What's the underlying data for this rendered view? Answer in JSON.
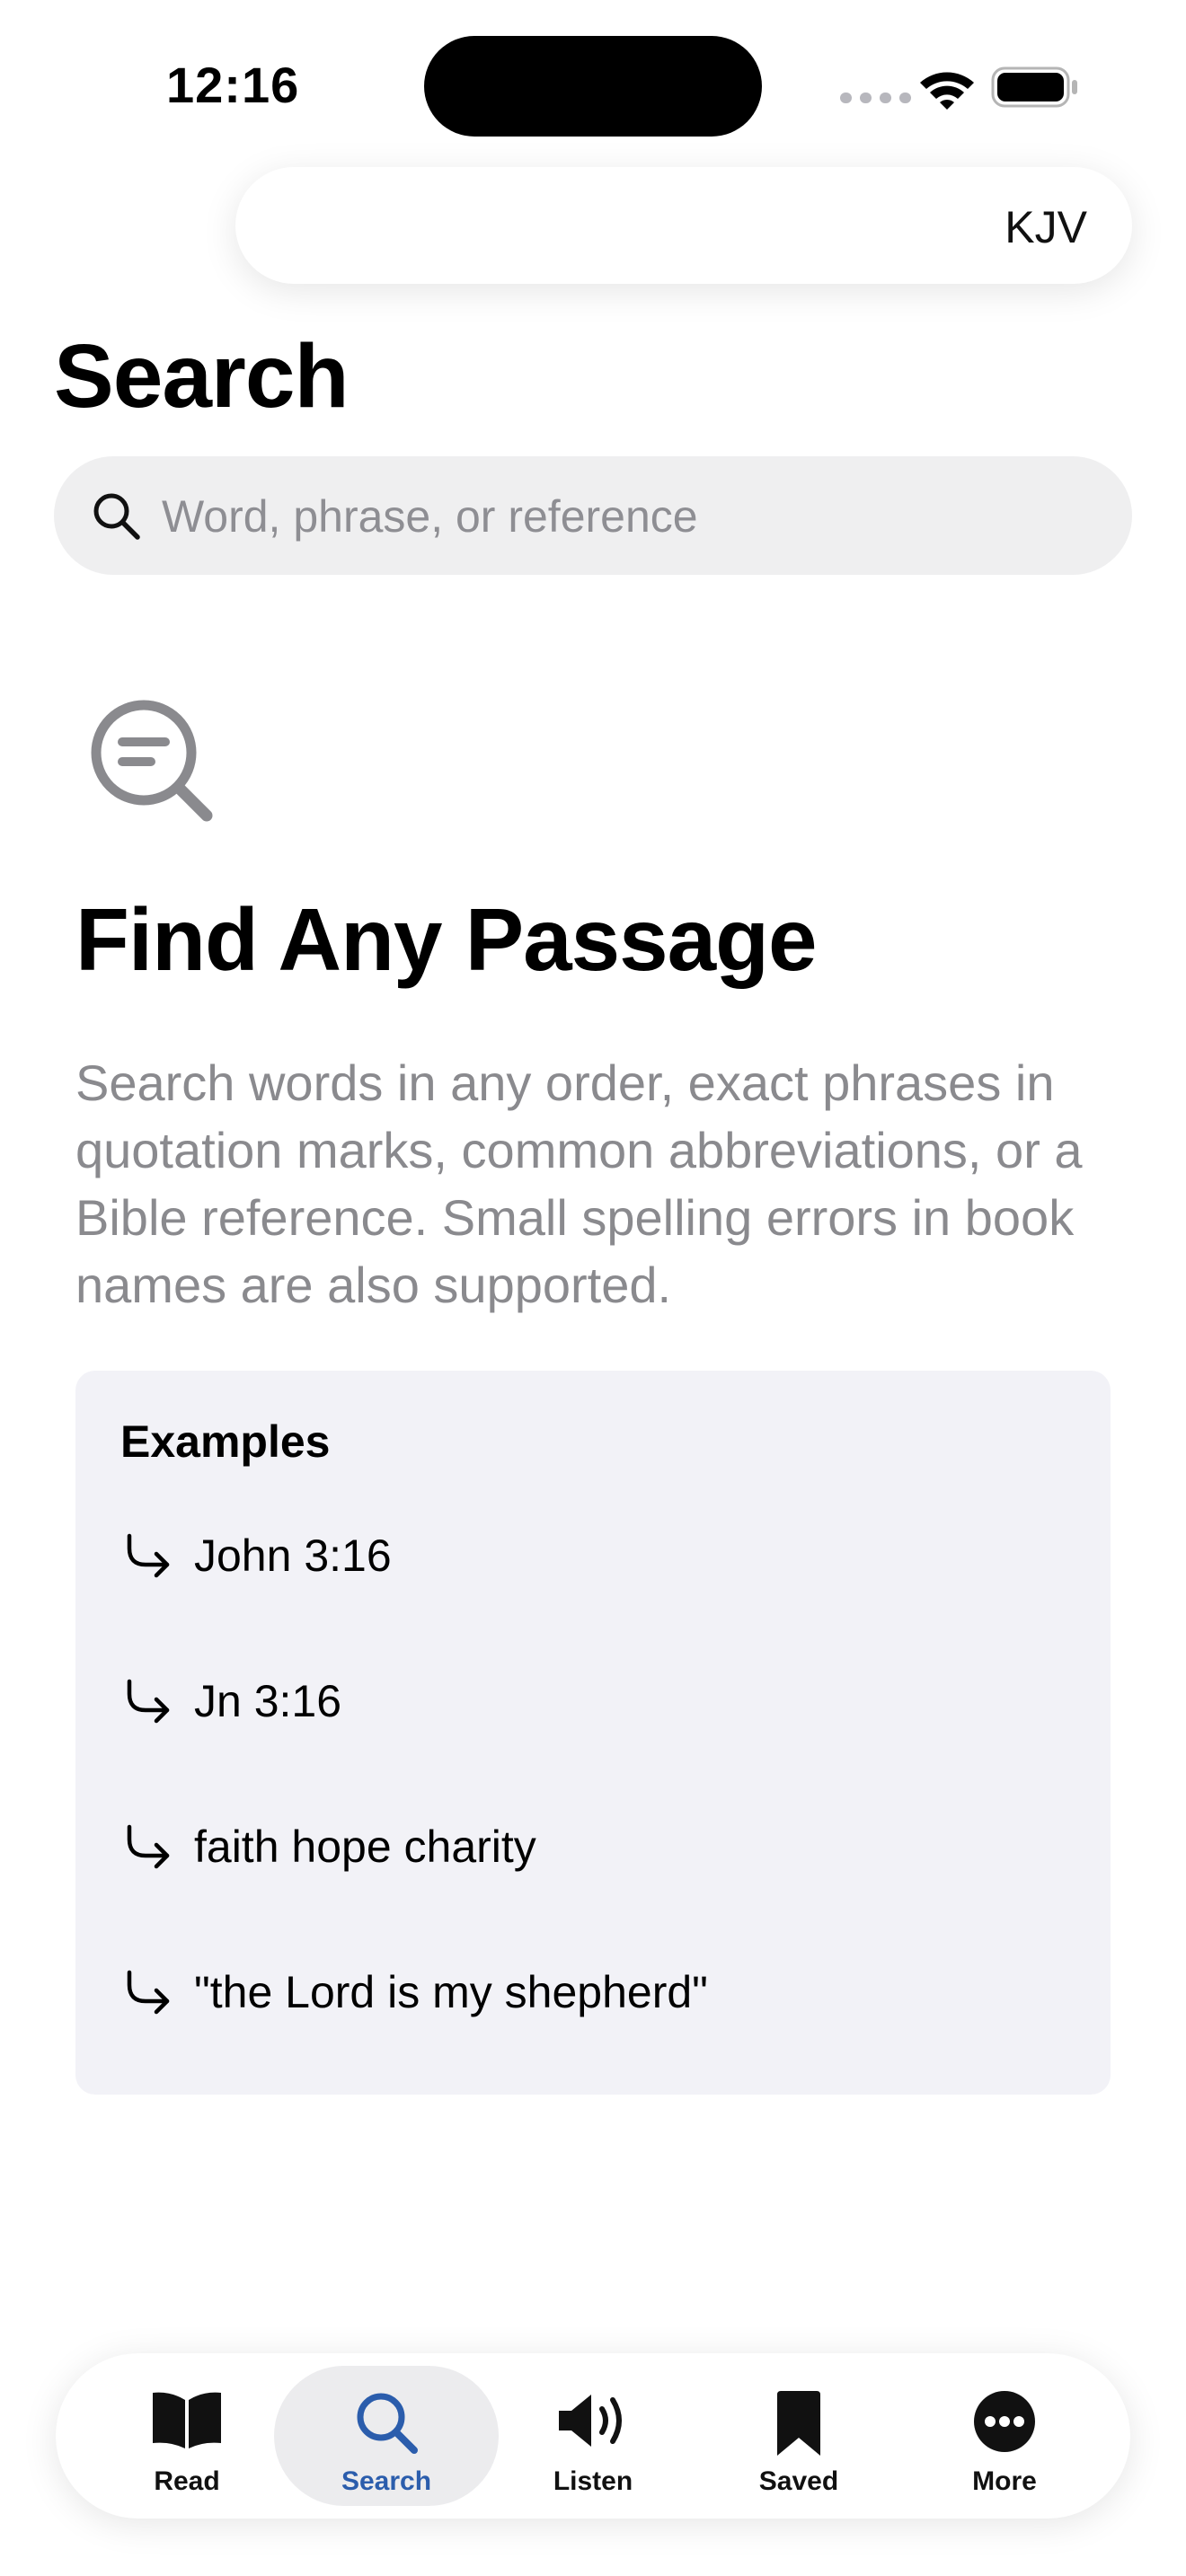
{
  "status_bar": {
    "time": "12:16"
  },
  "header": {
    "version": "KJV"
  },
  "page": {
    "title": "Search"
  },
  "search": {
    "placeholder": "Word, phrase, or reference",
    "value": ""
  },
  "hero": {
    "icon": "magnifier-lines-icon",
    "title": "Find Any Passage",
    "description": "Search words in any order, exact phrases in quotation marks, common abbreviations, or a Bible reference. Small spelling errors in book names are also supported."
  },
  "examples": {
    "title": "Examples",
    "items": [
      {
        "icon": "arrow-turn-right-icon",
        "label": "John 3:16"
      },
      {
        "icon": "arrow-turn-right-icon",
        "label": "Jn 3:16"
      },
      {
        "icon": "arrow-turn-right-icon",
        "label": "faith hope charity"
      },
      {
        "icon": "arrow-turn-right-icon",
        "label": "\"the Lord is my shepherd\""
      }
    ]
  },
  "tab_bar": {
    "active": "Search",
    "accent_color": "#2b5dac",
    "tabs": [
      {
        "label": "Read",
        "icon": "book-open-icon"
      },
      {
        "label": "Search",
        "icon": "search-icon"
      },
      {
        "label": "Listen",
        "icon": "speaker-icon"
      },
      {
        "label": "Saved",
        "icon": "bookmark-icon"
      },
      {
        "label": "More",
        "icon": "more-icon"
      }
    ]
  }
}
